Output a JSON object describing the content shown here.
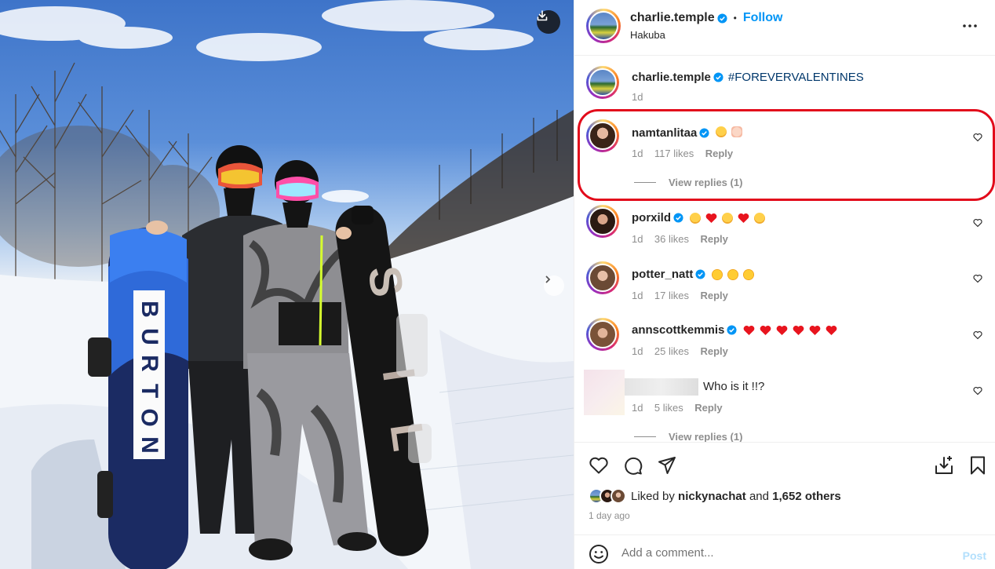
{
  "post": {
    "author": "charlie.temple",
    "follow_label": "Follow",
    "separator": "•",
    "location": "Hakuba",
    "more_icon": "more-horizontal-icon",
    "caption": {
      "author": "charlie.temple",
      "text": "#FOREVERVALENTINES",
      "time": "1d"
    }
  },
  "board": {
    "brand": [
      "B",
      "U",
      "R",
      "T",
      "O",
      "N"
    ]
  },
  "comments": [
    {
      "user": "namtanlitaa",
      "verified": true,
      "emojis": [
        "face-emoji",
        "hands-emoji"
      ],
      "time": "1d",
      "likes": "117 likes",
      "reply": "Reply",
      "view_replies": "View replies (1)"
    },
    {
      "user": "porxild",
      "verified": true,
      "emojis": [
        "face-emoji",
        "heart-emoji",
        "face-emoji",
        "heart-emoji",
        "face-emoji"
      ],
      "time": "1d",
      "likes": "36 likes",
      "reply": "Reply"
    },
    {
      "user": "potter_natt",
      "verified": true,
      "emojis": [
        "heart-eyes-emoji",
        "heart-eyes-emoji",
        "heart-eyes-emoji"
      ],
      "time": "1d",
      "likes": "17 likes",
      "reply": "Reply"
    },
    {
      "user": "annscottkemmis",
      "verified": true,
      "emojis": [
        "heart-emoji",
        "heart-emoji",
        "heart-emoji",
        "heart-emoji",
        "heart-emoji",
        "heart-emoji"
      ],
      "time": "1d",
      "likes": "25 likes",
      "reply": "Reply"
    },
    {
      "user": "",
      "text": "Who is it !!?",
      "time": "1d",
      "likes": "5 likes",
      "reply": "Reply",
      "view_replies": "View replies (1)"
    }
  ],
  "likes": {
    "prefix": "Liked by",
    "user": "nickynachat",
    "middle": "and",
    "count": "1,652 others"
  },
  "time_ago": "1 day ago",
  "add_comment": {
    "placeholder": "Add a comment...",
    "post_label": "Post"
  },
  "colors": {
    "follow": "#0095f6",
    "verified": "#0095f6",
    "highlight": "#e20b1b"
  }
}
